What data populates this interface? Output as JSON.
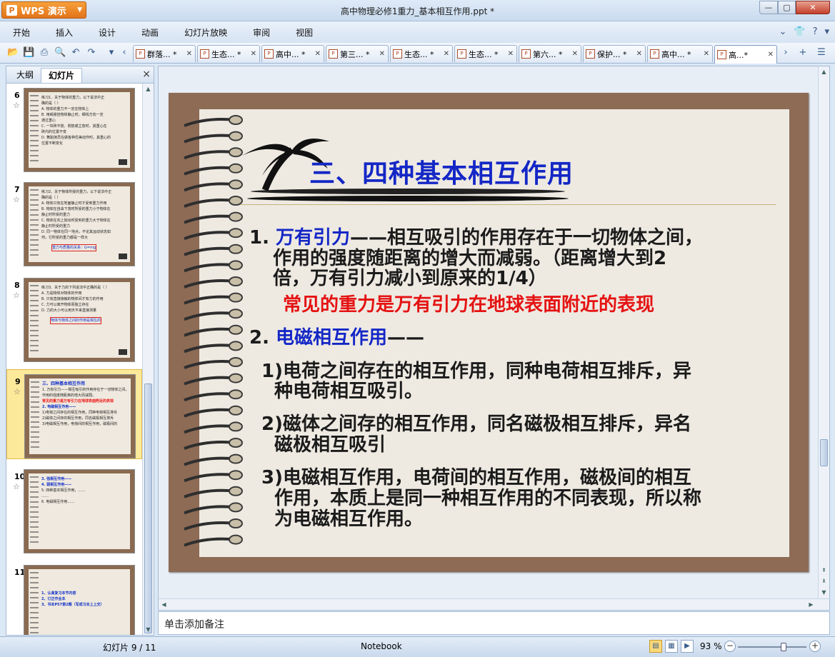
{
  "app": {
    "badge_label": "WPS 演示",
    "window_title": "高中物理必修1重力_基本相互作用.ppt *"
  },
  "menu": [
    "开始",
    "插入",
    "设计",
    "动画",
    "幻灯片放映",
    "审阅",
    "视图"
  ],
  "doc_tabs": [
    {
      "label": "群落... *"
    },
    {
      "label": "生态... *"
    },
    {
      "label": "高中... *"
    },
    {
      "label": "第三... *"
    },
    {
      "label": "生态... *"
    },
    {
      "label": "生态... *"
    },
    {
      "label": "第六... *"
    },
    {
      "label": "保护... *"
    },
    {
      "label": "高中... *"
    },
    {
      "label": "高...*"
    }
  ],
  "panel": {
    "tab_outline": "大纲",
    "tab_slides": "幻灯片",
    "close": "×"
  },
  "thumbnails": [
    {
      "num": "6",
      "lines": [
        "练习1、关于物体的重力，以下说法中正",
        "确的是（   ）",
        "A. 物体的重力不一定在物体上",
        "B. 用绳悬挂物体静止时，细线方向一定",
        "   通过重心",
        "C. 一块砖平放、侧放或立放时，其重心在",
        "   砖内的位置不变",
        "D. 舞蹈演员在做各种优美动作时，其重心的",
        "   位置不断变化"
      ]
    },
    {
      "num": "7",
      "lines": [
        "练习2、关于物体所受的重力，以下说法中正",
        "确的是（   ）",
        "A. 物体只有在地面静止时才受到重力作用",
        "B. 物体在自由下落时所受的重力小于物体在",
        "   静止时所受的重力",
        "C. 物体在向上抛出时受到的重力大于物体在",
        "   静止时所受的重力",
        "D. 同一物体在同一地点，不论其运动状态如",
        "   何，它所受的重力都是一样大",
        "重力与质量的关系：G=mg"
      ]
    },
    {
      "num": "8",
      "lines": [
        "练习3、关于力的下列说法中正确的是（   ）",
        "A. 力是物体对物体的作用",
        "B. 只有直接接触的物体间才有力的作用",
        "C. 力可以离开物体而独立存在",
        "D. 力的大小可以用天平来直接测量",
        "物体与物体之间的作用是相互的"
      ]
    },
    {
      "num": "9",
      "lines": [
        "三、四种基本相互作用",
        "1. 万有引力——相互吸引的作用存在于一切物体之间，",
        "   作用的强度随距离的增大而减弱。",
        "   常见的重力是万有引力在地球表面附近的表现",
        "2. 电磁相互作用——",
        "   1)电荷之间存在的相互作用，同种电荷相互排斥",
        "   2)磁体之间存的相互作用，同名磁极相互排斥",
        "   3)电磁相互作用，电荷间的相互作用，磁极间的"
      ]
    },
    {
      "num": "10",
      "lines": [
        "3. 强相互作用——",
        "4. 弱相互作用——",
        "5. 四种基本相互作用，……",
        "   ……",
        "6. 电磁相互作用……"
      ]
    },
    {
      "num": "11",
      "lines": [
        "1、认真复习本节内容",
        "2、订正作业本",
        "3、书本P57第2题（写成习本上上交）"
      ]
    }
  ],
  "slide": {
    "title": "三、四种基本相互作用",
    "p1_num": "1. ",
    "p1_term": "万有引力",
    "p1_rest": "——相互吸引的作用存在于一切物体之间，",
    "p1_line2": "作用的强度随距离的增大而减弱。（距离增大到2",
    "p1_line3": "倍，万有引力减小到原来的1/4）",
    "p1_red": "常见的重力是万有引力在地球表面附近的表现",
    "p2_num": "2. ",
    "p2_term": "电磁相互作用",
    "p2_rest": "——",
    "s1_line1": "1)电荷之间存在的相互作用，同种电荷相互排斥，异",
    "s1_line2": "种电荷相互吸引。",
    "s2_line1": "2)磁体之间存的相互作用，同名磁极相互排斥，异名",
    "s2_line2": "磁极相互吸引",
    "s3_line1": "3)电磁相互作用，电荷间的相互作用，磁极间的相互",
    "s3_line2": "作用，本质上是同一种相互作用的不同表现，所以称",
    "s3_line3": "为电磁相互作用。"
  },
  "notes_placeholder": "单击添加备注",
  "status": {
    "slide_info": "幻灯片 9 / 11",
    "template": "Notebook",
    "zoom": "93 %",
    "zoom_level_percent": 93
  }
}
